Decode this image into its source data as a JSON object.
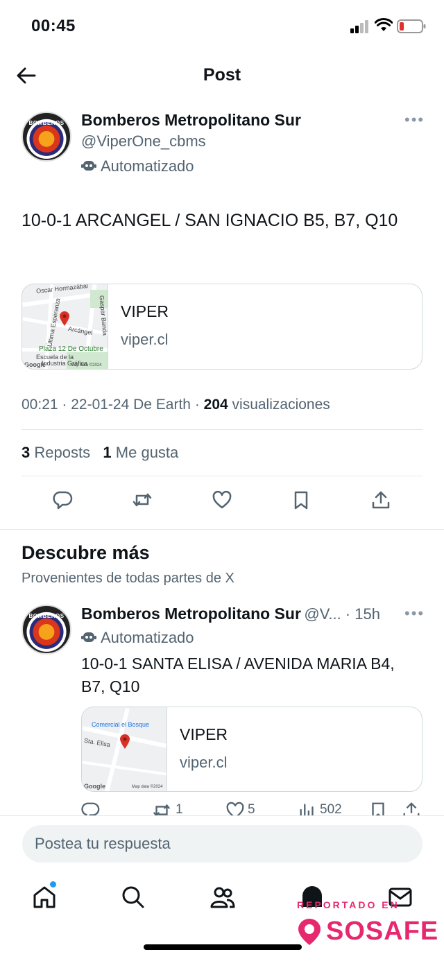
{
  "status_bar": {
    "time": "00:45"
  },
  "header": {
    "title": "Post"
  },
  "post": {
    "author_name": "Bomberos Metropolitano Sur",
    "handle": "@ViperOne_cbms",
    "automated_label": "Automatizado",
    "avatar_text": "BOMBEROS",
    "text": "10-0-1 ARCANGEL / SAN IGNACIO B5, B7, Q10",
    "card": {
      "title": "VIPER",
      "domain": "viper.cl",
      "map_labels": [
        "Oscar Hormazábal",
        "Gaspar Banda",
        "Última Esperanza",
        "Arcángel",
        "Plaza 12 De Octubre",
        "Escuela de la",
        "Industria Gráfica",
        "Google",
        "Map data ©2024"
      ]
    },
    "meta": {
      "time_date": "00:21 · 22-01-24 De Earth · ",
      "views": "204",
      "views_label": " visualizaciones"
    },
    "stats": {
      "reposts_count": "3",
      "reposts_label": " Reposts",
      "likes_count": "1",
      "likes_label": " Me gusta"
    }
  },
  "discover": {
    "title": "Descubre más",
    "subtitle": "Provenientes de todas partes de X",
    "tweet": {
      "author_name": "Bomberos Metropolitano Sur",
      "handle_time": "@V... · 15h",
      "automated_label": "Automatizado",
      "text": "10-0-1 SANTA ELISA / AVENIDA MARIA B4, B7, Q10",
      "card": {
        "title": "VIPER",
        "domain": "viper.cl",
        "map_labels": [
          "Comercial el Bosque",
          "Sta. Elisa",
          "Google",
          "Map data ©2024"
        ]
      },
      "actions": {
        "reposts": "1",
        "likes": "5",
        "views": "502"
      }
    }
  },
  "reply": {
    "placeholder": "Postea tu respuesta"
  },
  "watermark": {
    "small": "REPORTADO EN",
    "big": "SOSAFE"
  },
  "icons": [
    "back-arrow-icon",
    "reply-icon",
    "repost-icon",
    "like-icon",
    "bookmark-icon",
    "share-icon",
    "home-icon",
    "search-icon",
    "communities-icon",
    "grok-icon",
    "messages-icon"
  ],
  "colors": {
    "accent": "#1d9bf0",
    "pin": "#d93025",
    "sosafe": "#e6286e",
    "battery_low": "#e0312c"
  }
}
